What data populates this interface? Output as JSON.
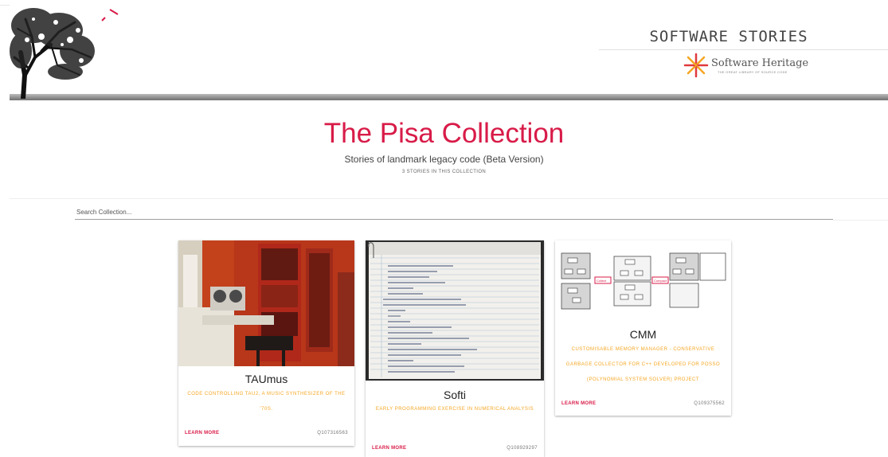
{
  "header": {
    "brand_title": "SOFTWARE STORIES",
    "partner_name": "Software Heritage",
    "partner_tagline": "THE GREAT LIBRARY OF SOURCE CODE",
    "icons": [
      "tree-logo-icon",
      "bird-icon",
      "software-heritage-logo-icon"
    ]
  },
  "collection": {
    "title": "The Pisa Collection",
    "subtitle": "Stories of landmark legacy code (Beta Version)",
    "count": "3 STORIES IN THIS COLLECTION"
  },
  "search": {
    "placeholder": "Search Collection..."
  },
  "stories": [
    {
      "title": "TAUmus",
      "description": "CODE CONTROLLING TAU2, A MUSIC SYNTHESIZER OF THE '70S.",
      "link_label": "LEARN MORE",
      "id": "Q107316563"
    },
    {
      "title": "Softi",
      "description": "EARLY PROGRAMMING EXERCISE IN NUMERICAL ANALYSIS",
      "link_label": "LEARN MORE",
      "id": "Q108929297"
    },
    {
      "title": "CMM",
      "description": "CUSTOMISABLE MEMORY MANAGER - CONSERVATIVE GARBAGE COLLECTOR FOR C++ DEVELOPED FOR POSSO (POLYNOMIAL SYSTEM SOLVER) PROJECT",
      "link_label": "LEARN MORE",
      "id": "Q109375562"
    }
  ],
  "diagram_labels": [
    "Collect",
    "Compact"
  ],
  "colors": {
    "accent": "#d81b48",
    "description": "#f5a623"
  }
}
